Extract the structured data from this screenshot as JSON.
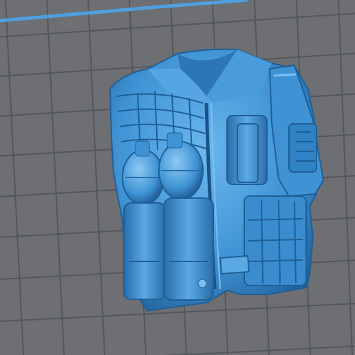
{
  "viewport": {
    "model": "tactical-vest",
    "colors": {
      "background": "#6d6f72",
      "grid_line": "#55575a",
      "model_base": "#3f93d4",
      "model_light": "#6bb7ee",
      "model_dark": "#1f5f97",
      "edge_highlight": "#4f9fe0"
    }
  }
}
